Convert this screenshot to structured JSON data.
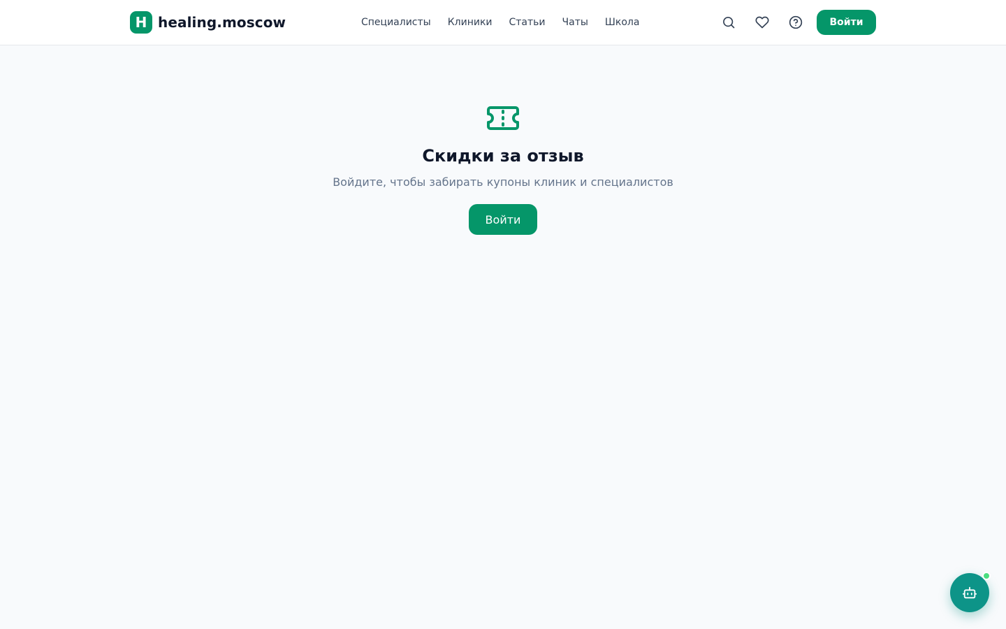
{
  "brand": {
    "mark": "H",
    "name": "healing.moscow",
    "accent_color": "#059669"
  },
  "nav": {
    "items": [
      {
        "label": "Специалисты"
      },
      {
        "label": "Клиники"
      },
      {
        "label": "Статьи"
      },
      {
        "label": "Чаты"
      },
      {
        "label": "Школа"
      }
    ]
  },
  "header_actions": {
    "icons": [
      "search-icon",
      "heart-icon",
      "help-circle-icon"
    ],
    "login_label": "Войти"
  },
  "main": {
    "icon": "ticket-icon",
    "title": "Скидки за отзыв",
    "subtitle": "Войдите, чтобы забирать купоны клиник и специалистов",
    "cta_label": "Войти"
  },
  "assistant": {
    "icon": "bot-icon",
    "status_color": "#4ade80"
  }
}
